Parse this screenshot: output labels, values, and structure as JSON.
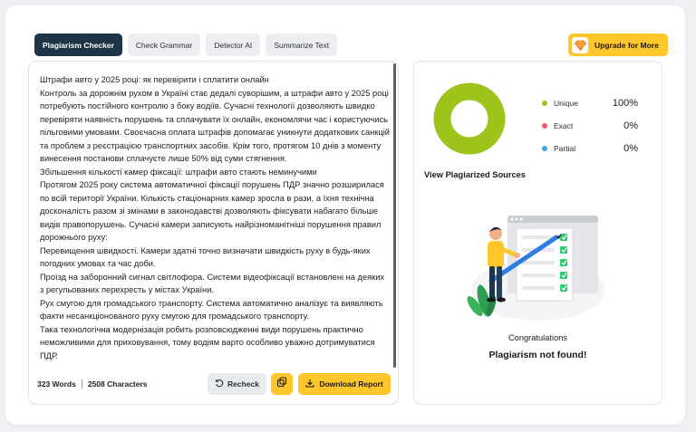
{
  "tabs": [
    {
      "label": "Plagiarism Checker",
      "active": true
    },
    {
      "label": "Check Grammar",
      "active": false
    },
    {
      "label": "Detector AI",
      "active": false
    },
    {
      "label": "Summarize Text",
      "active": false
    }
  ],
  "upgrade": {
    "label": "Upgrade for More",
    "icon": "diamond-icon"
  },
  "editor": {
    "paragraphs": [
      "Штрафи авто у 2025 році: як перевірити і сплатити онлайн",
      "Контроль за дорожнім рухом в Україні стає дедалі суворішим, а штрафи авто у 2025 році потребують постійного контролю з боку водіїв. Сучасні технології дозволяють швидко перевіряти наявність порушень та сплачувати їх онлайн, економлячи час і користуючись пільговими умовами. Своєчасна оплата штрафів допомагає уникнути додаткових санкцій та проблем з реєстрацією транспортних засобів. Крім того, протягом 10 днів з моменту винесення постанови сплачуєте лише 50% від суми стягнення.",
      "Збільшення кількості камер фіксації: штрафи авто стають неминучими",
      "Протягом 2025 року система автоматичної фіксації порушень ПДР значно розширилася по всій території України. Кількість стаціонарних камер зросла в рази, а їхня технічна досконалість разом зі змінами в законодавстві дозволяють фіксувати набагато більше видів правопорушень. Сучасні камери записують найрізноманітніші порушення правил дорожнього руху:",
      "Перевищення швидкості. Камери здатні точно визначати швидкість руху в будь-яких погодних умовах та час доби.",
      "Проїзд на заборонний сигнал світлофора. Системи відеофіксації встановлені на деяких з регульованих перехресть у містах України.",
      "Рух смугою для громадського транспорту. Система автоматично аналізує та виявляють факти несанкціонованого руху смугою для громадського транспорту.",
      "Така технологічна модернізація робить розповсюдженні види порушень практично неможливими для приховування, тому водіям варто особливо уважно дотримуватися ПДР."
    ],
    "word_count": "323 Words",
    "char_count": "2508 Characters",
    "recheck_label": "Recheck",
    "download_label": "Download Report"
  },
  "results": {
    "legend": [
      {
        "name": "Unique",
        "pct": "100%",
        "value": 100,
        "color": "#9ec31b"
      },
      {
        "name": "Exact",
        "pct": "0%",
        "value": 0,
        "color": "#f0596a"
      },
      {
        "name": "Partial",
        "pct": "0%",
        "value": 0,
        "color": "#3fa7d6"
      }
    ],
    "view_sources": "View Plagiarized Sources",
    "congrats": "Congratulations",
    "not_found": "Plagiarism not found!"
  },
  "colors": {
    "accent": "#ffc72c",
    "active_tab": "#1e3447",
    "unique": "#9ec31b"
  }
}
